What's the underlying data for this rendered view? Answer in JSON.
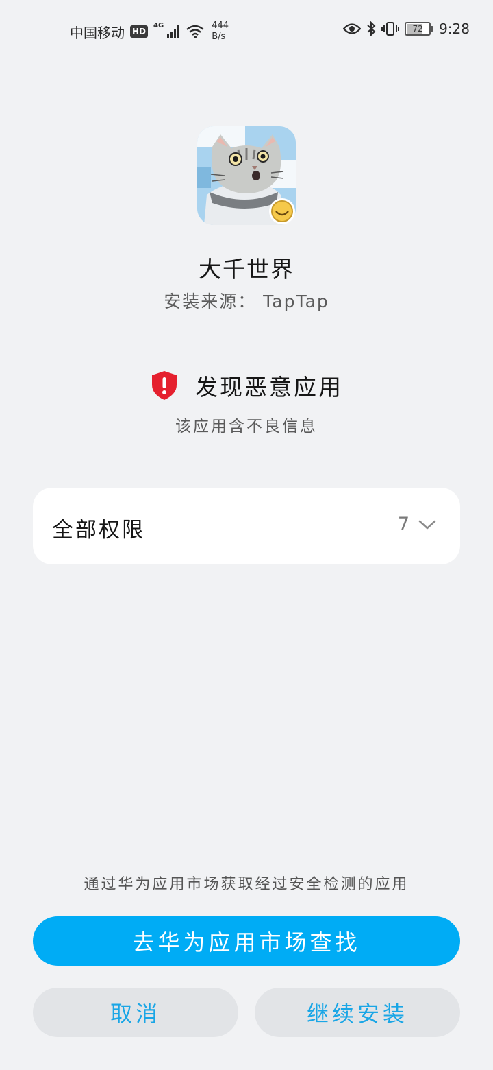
{
  "status_bar": {
    "carrier": "中国移动",
    "hd": "HD",
    "network_type": "4G",
    "speed_value": "444",
    "speed_unit": "B/s",
    "battery_level": "72",
    "time": "9:28"
  },
  "app": {
    "name": "大千世界",
    "source": "安装来源： TapTap",
    "icon": "pixel-cat-icon"
  },
  "warning": {
    "title": "发现恶意应用",
    "subtitle": "该应用含不良信息",
    "icon": "shield-alert-icon",
    "color": "#e5202e"
  },
  "permissions": {
    "label": "全部权限",
    "count": "7"
  },
  "footer": {
    "hint": "通过华为应用市场获取经过安全检测的应用",
    "primary_button": "去华为应用市场查找",
    "cancel_button": "取消",
    "continue_button": "继续安装"
  },
  "colors": {
    "accent": "#00acf5",
    "background": "#f1f2f4",
    "secondary_button_bg": "#e2e4e7",
    "secondary_button_text": "#1aa6e6"
  }
}
